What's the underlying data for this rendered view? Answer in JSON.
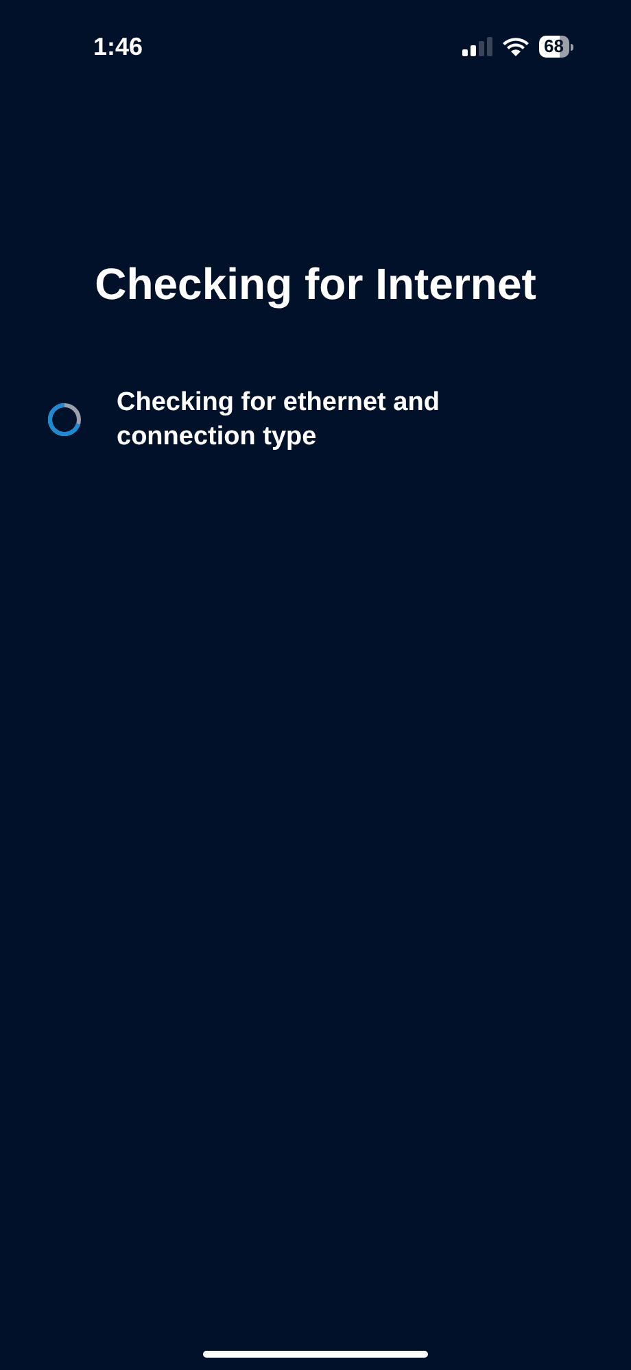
{
  "status_bar": {
    "time": "1:46",
    "battery": "68"
  },
  "title": "Checking for Internet",
  "steps": [
    {
      "kind": "loading",
      "label": "Checking for ethernet and connection type"
    }
  ]
}
